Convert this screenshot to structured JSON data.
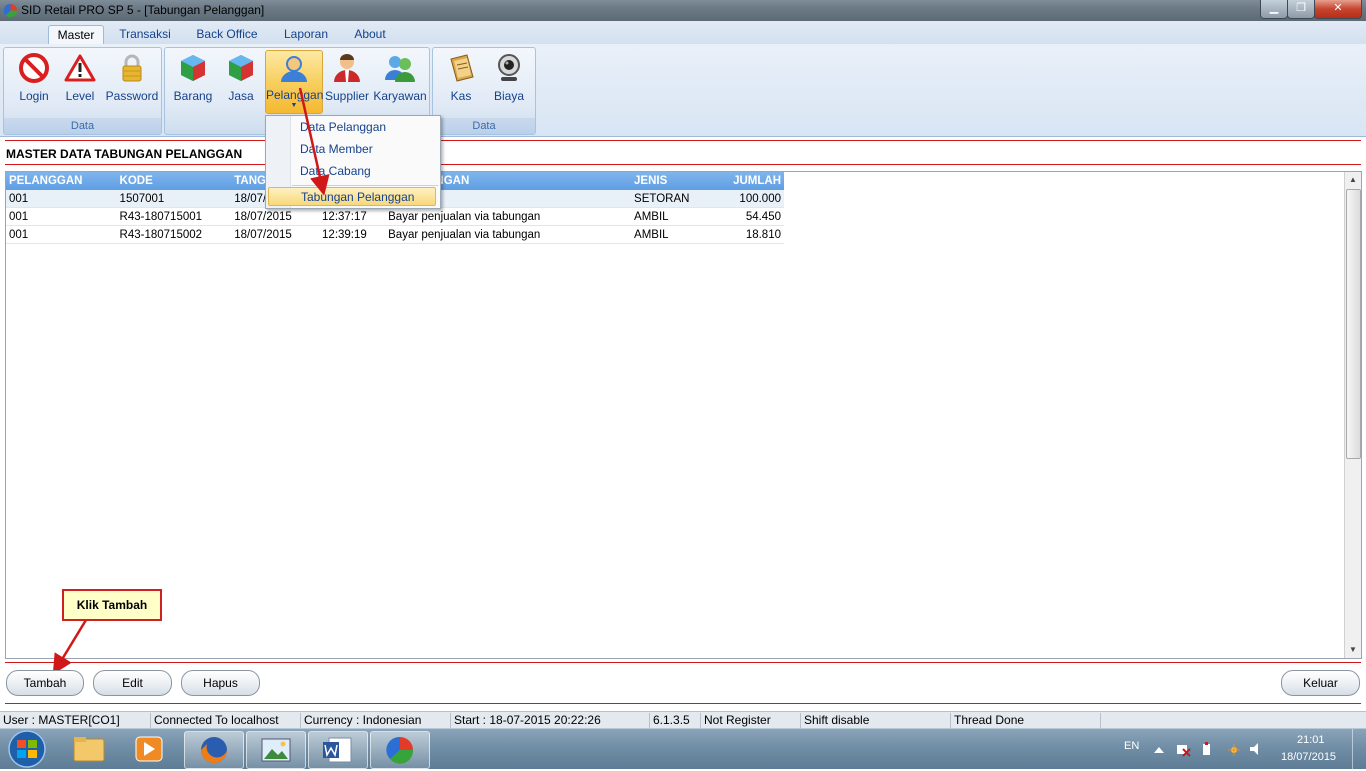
{
  "window": {
    "title": "SID Retail PRO SP 5 - [Tabungan Pelanggan]",
    "minimize": "▁",
    "maximize": "❐",
    "close": "✕"
  },
  "ribbon_tabs": [
    "Master",
    "Transaksi",
    "Back Office",
    "Laporan",
    "About"
  ],
  "ribbon_groups": {
    "group1_label": "Data",
    "group3_label": "Data"
  },
  "ribbon_buttons": {
    "login": "Login",
    "level": "Level",
    "password": "Password",
    "barang": "Barang",
    "jasa": "Jasa",
    "pelanggan": "Pelanggan",
    "supplier": "Supplier",
    "karyawan": "Karyawan",
    "kas": "Kas",
    "biaya": "Biaya"
  },
  "dropdown": {
    "items": [
      "Data Pelanggan",
      "Data Member",
      "Data Cabang",
      "Tabungan Pelanggan"
    ]
  },
  "page_title": "MASTER DATA TABUNGAN PELANGGAN",
  "grid": {
    "headers": [
      "PELANGGAN",
      "KODE",
      "TANGGAL",
      "",
      "KETERANGAN",
      "JENIS",
      "JUMLAH"
    ],
    "rows": [
      [
        "001",
        "1507001",
        "18/07/2015",
        "",
        "",
        "SETORAN",
        "100.000"
      ],
      [
        "001",
        "R43-180715001",
        "18/07/2015",
        "12:37:17",
        "Bayar penjualan via tabungan",
        "AMBIL",
        "54.450"
      ],
      [
        "001",
        "R43-180715002",
        "18/07/2015",
        "12:39:19",
        "Bayar penjualan via tabungan",
        "AMBIL",
        "18.810"
      ]
    ]
  },
  "callout": "Klik Tambah",
  "buttons": {
    "tambah": "Tambah",
    "edit": "Edit",
    "hapus": "Hapus",
    "keluar": "Keluar"
  },
  "statusbar": {
    "user": "User : MASTER[CO1]",
    "connection": "Connected To localhost",
    "currency": "Currency : Indonesian",
    "start": "Start  : 18-07-2015 20:22:26",
    "version": "6.1.3.5",
    "register": "Not Register",
    "shift": "Shift disable",
    "thread": "Thread Done"
  },
  "taskbar": {
    "language": "EN",
    "time": "21:01",
    "date": "18/07/2015"
  },
  "colors": {
    "accent_red": "#d01818",
    "grid_header": "#5f9ee3",
    "ribbon_text": "#15428b"
  }
}
